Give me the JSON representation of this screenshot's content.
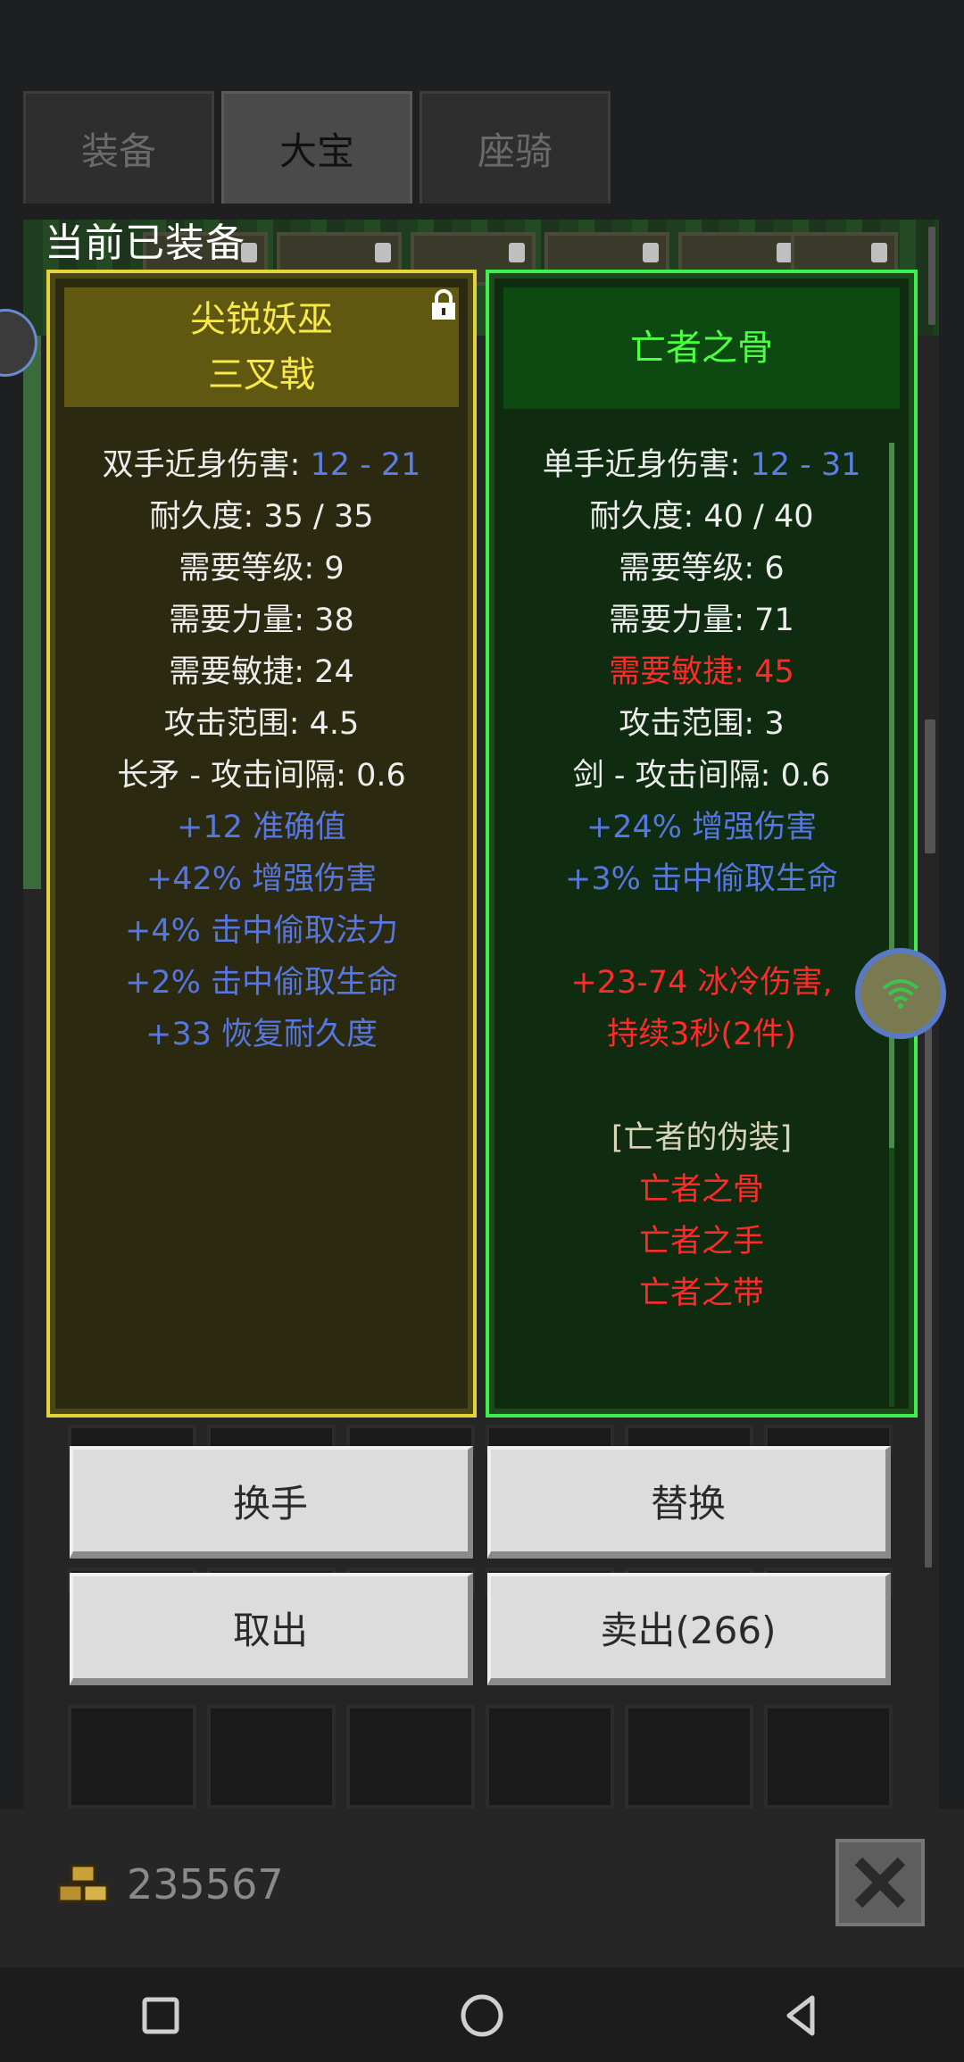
{
  "tabs": [
    {
      "label": "装备",
      "active": false
    },
    {
      "label": "大宝",
      "active": true
    },
    {
      "label": "座骑",
      "active": false
    }
  ],
  "equipped_title": "当前已装备",
  "left_item": {
    "name_line1": "尖锐妖巫",
    "name_line2": "三叉戟",
    "locked": true,
    "stats": [
      {
        "label": "双手近身伤害: ",
        "value": "12 - 21"
      },
      {
        "label": "耐久度: 35 / 35"
      },
      {
        "label": "需要等级: 9"
      },
      {
        "label": "需要力量: 38"
      },
      {
        "label": "需要敏捷: 24"
      },
      {
        "label": "攻击范围: 4.5"
      },
      {
        "label": "长矛 - 攻击间隔: 0.6"
      }
    ],
    "mods": [
      "+12 准确值",
      "+42% 增强伤害",
      "+4% 击中偷取法力",
      "+2% 击中偷取生命",
      "+33 恢复耐久度"
    ]
  },
  "right_item": {
    "name": "亡者之骨",
    "stats": [
      {
        "label": "单手近身伤害: ",
        "value": "12 - 31"
      },
      {
        "label": "耐久度: 40 / 40"
      },
      {
        "label": "需要等级: 6"
      },
      {
        "label": "需要力量: 71"
      },
      {
        "label": "需要敏捷: 45",
        "unmet": true
      },
      {
        "label": "攻击范围: 3"
      },
      {
        "label": "剑 - 攻击间隔: 0.6"
      }
    ],
    "mods": [
      "+24% 增强伤害",
      "+3% 击中偷取生命"
    ],
    "set_bonus_line1": "+23-74 冰冷伤害,",
    "set_bonus_line2": "持续3秒(2件)",
    "set_name": "[亡者的伪装]",
    "set_items": [
      "亡者之骨",
      "亡者之手",
      "亡者之带"
    ]
  },
  "buttons": {
    "swap_hand": "换手",
    "replace": "替换",
    "take_out": "取出",
    "sell": "卖出(266)"
  },
  "gold": "235567",
  "colors": {
    "left_border": "#e5d33a",
    "right_border": "#3cf14a",
    "mod_blue": "#5677e0",
    "unmet_red": "#ff2a2a"
  },
  "icons": [
    "lock-icon",
    "gold-coins-icon",
    "close-icon",
    "wifi-icon",
    "nav-square-icon",
    "nav-circle-icon",
    "nav-back-icon"
  ]
}
